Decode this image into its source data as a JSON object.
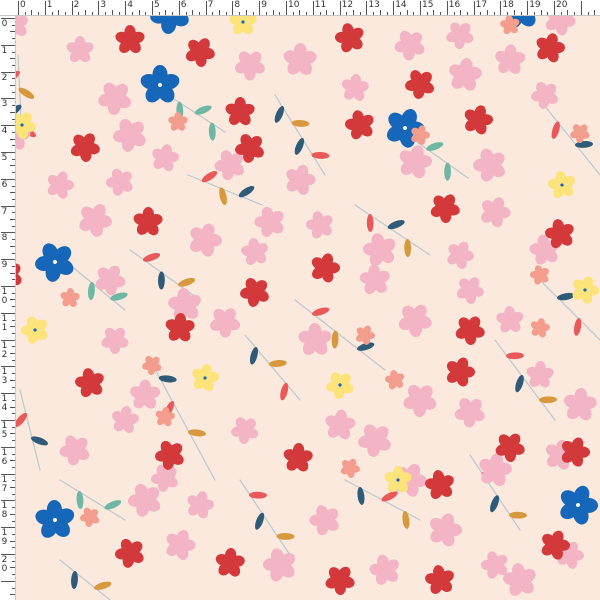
{
  "ruler": {
    "horizontal_labels": [
      "0",
      "1",
      "2",
      "3",
      "4",
      "5",
      "6",
      "7",
      "8",
      "9",
      "10",
      "11",
      "12",
      "13",
      "14",
      "15",
      "16",
      "17",
      "18",
      "19",
      "20"
    ],
    "vertical_labels": [
      "0",
      "1",
      "2",
      "3",
      "4",
      "5",
      "6",
      "7",
      "8",
      "9",
      "10",
      "11",
      "12",
      "13",
      "14",
      "15",
      "16",
      "17",
      "18",
      "19",
      "20"
    ]
  },
  "palette": {
    "background": "#fbe9dd",
    "pink_flower": "#f3b4c6",
    "red_flower": "#d3383a",
    "blue_flower": "#1667b9",
    "yellow_flower": "#fde47a",
    "salmon_flower": "#f29d8e",
    "leaf_navy": "#2f5a78",
    "leaf_mustard": "#d8983d",
    "leaf_teal": "#6db7a4",
    "leaf_coral": "#e9595a",
    "stem": "#b9c9cf"
  },
  "icons": [
    "pink-flower-icon",
    "red-flower-icon",
    "blue-flower-icon",
    "yellow-flower-icon",
    "salmon-flower-icon",
    "leaf-sprig-icon"
  ]
}
